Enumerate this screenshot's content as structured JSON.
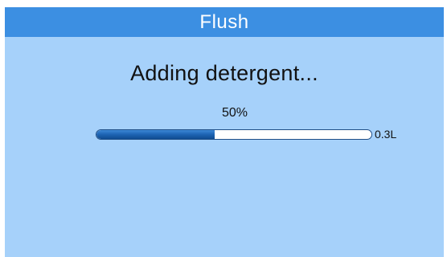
{
  "header": {
    "title": "Flush"
  },
  "status": {
    "message": "Adding detergent..."
  },
  "progress": {
    "percent_label": "50%",
    "value": 0.43,
    "volume_label": "0.3L"
  },
  "colors": {
    "screen_background": "#a6d1fa",
    "titlebar_background": "#3c8fe2",
    "title_text": "#ffffff",
    "text": "#111111",
    "progress_fill": "#1f66b6",
    "progress_track": "#ffffff",
    "progress_border": "#1f4e86"
  }
}
